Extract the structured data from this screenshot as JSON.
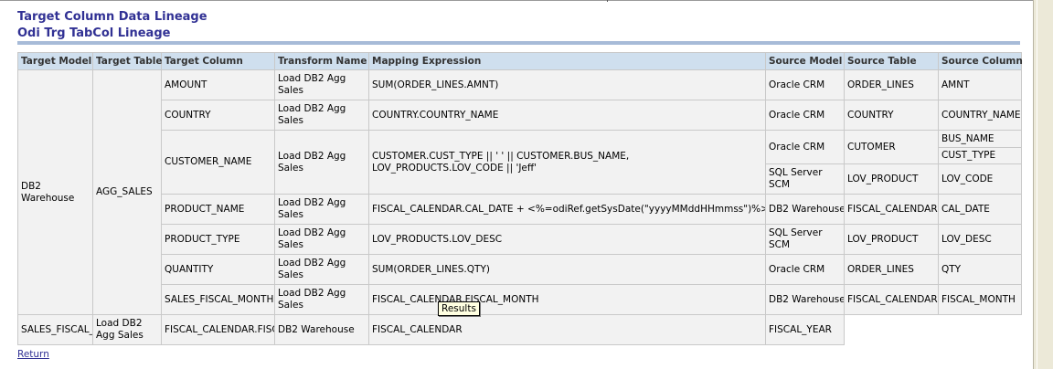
{
  "page": {
    "title": "Target Column Data Lineage",
    "subtitle": "Odi Trg TabCol Lineage",
    "return_label": "Return",
    "tooltip": "Results"
  },
  "table": {
    "headers": {
      "target_model": "Target Model",
      "target_table": "Target Table",
      "target_column": "Target Column",
      "transform_name": "Transform Name",
      "mapping_expression": "Mapping Expression",
      "source_model": "Source Model",
      "source_table": "Source Table",
      "source_column": "Source Column"
    },
    "target_model": "DB2 Warehouse",
    "target_table": "AGG_SALES",
    "rows": [
      {
        "target_column": "AMOUNT",
        "transform": "Load DB2 Agg Sales",
        "expression": "SUM(ORDER_LINES.AMNT)",
        "source_model": "Oracle CRM",
        "source_table": "ORDER_LINES",
        "source_column": "AMNT"
      },
      {
        "target_column": "COUNTRY",
        "transform": "Load DB2 Agg Sales",
        "expression": "COUNTRY.COUNTRY_NAME",
        "source_model": "Oracle CRM",
        "source_table": "COUNTRY",
        "source_column": "COUNTRY_NAME"
      },
      {
        "target_column": "CUSTOMER_NAME",
        "transform": "Load DB2 Agg Sales",
        "expression": "CUSTOMER.CUST_TYPE || ' ' || CUSTOMER.BUS_NAME, LOV_PRODUCTS.LOV_CODE || 'Jeff'",
        "source_model": "Oracle CRM",
        "source_table": "CUTOMER",
        "source_column": "BUS_NAME",
        "source_column_2": "CUST_TYPE",
        "source_model_2": "SQL Server SCM",
        "source_table_2": "LOV_PRODUCT",
        "source_column_3": "LOV_CODE"
      },
      {
        "target_column": "PRODUCT_NAME",
        "transform": "Load DB2 Agg Sales",
        "expression": "FISCAL_CALENDAR.CAL_DATE + <%=odiRef.getSysDate(\"yyyyMMddHHmmss\")%>",
        "source_model": "DB2 Warehouse",
        "source_table": "FISCAL_CALENDAR",
        "source_column": "CAL_DATE"
      },
      {
        "target_column": "PRODUCT_TYPE",
        "transform": "Load DB2 Agg Sales",
        "expression": "LOV_PRODUCTS.LOV_DESC",
        "source_model": "SQL Server SCM",
        "source_table": "LOV_PRODUCT",
        "source_column": "LOV_DESC"
      },
      {
        "target_column": "QUANTITY",
        "transform": "Load DB2 Agg Sales",
        "expression": "SUM(ORDER_LINES.QTY)",
        "source_model": "Oracle CRM",
        "source_table": "ORDER_LINES",
        "source_column": "QTY"
      },
      {
        "target_column": "SALES_FISCAL_MONTH",
        "transform": "Load DB2 Agg Sales",
        "expression": "FISCAL_CALENDAR.FISCAL_MONTH",
        "source_model": "DB2 Warehouse",
        "source_table": "FISCAL_CALENDAR",
        "source_column": "FISCAL_MONTH"
      },
      {
        "target_column": "SALES_FISCAL_YEAR",
        "transform": "Load DB2 Agg Sales",
        "expression": "FISCAL_CALENDAR.FISCAL_YEAR",
        "source_model": "DB2 Warehouse",
        "source_table": "FISCAL_CALENDAR",
        "source_column": "FISCAL_YEAR"
      }
    ]
  },
  "colors": {
    "title": "#313194",
    "header_bg": "#cfdfee",
    "cell_bg": "#f2f2f2",
    "divider": "#a7bbd8"
  }
}
